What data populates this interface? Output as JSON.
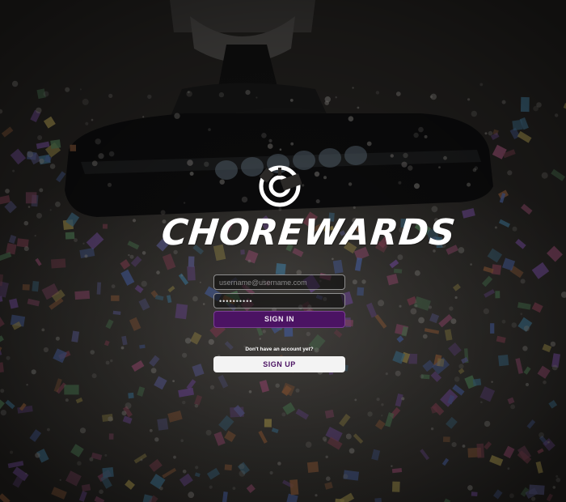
{
  "app": {
    "brand_name": "CHOREWARDS"
  },
  "icons": {
    "logo": "chorewards-logo-icon"
  },
  "colors": {
    "accent_purple": "#4b1363",
    "signup_background": "#f3f3f3",
    "text_white": "#ffffff"
  },
  "login_form": {
    "email_placeholder": "username@username.com",
    "email_value": "",
    "password_value": "••••••••••",
    "signin_label": "SIGN IN"
  },
  "signup": {
    "prompt": "Don't have an account yet?",
    "button_label": "SIGN UP"
  }
}
